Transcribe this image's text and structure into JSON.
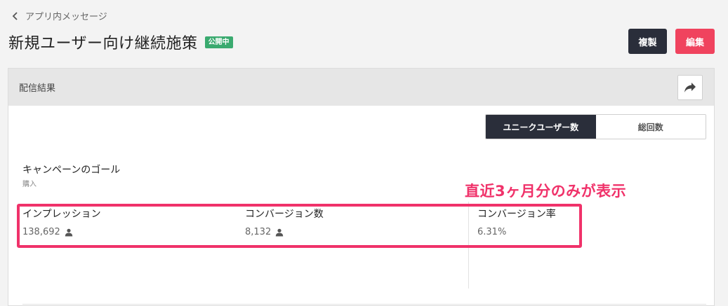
{
  "nav": {
    "back_label": "アプリ内メッセージ"
  },
  "header": {
    "title": "新規ユーザー向け継続施策",
    "status": "公開中",
    "duplicate_label": "複製",
    "edit_label": "編集"
  },
  "results": {
    "section_title": "配信結果",
    "toggle": {
      "unique_users": "ユニークユーザー数",
      "total_count": "総回数"
    },
    "goal": {
      "label": "キャンペーンのゴール",
      "value": "購入"
    },
    "annotation": "直近3ヶ月分のみが表示",
    "metrics": [
      {
        "label": "インプレッション",
        "value": "138,692",
        "icon": "user-icon"
      },
      {
        "label": "コンバージョン数",
        "value": "8,132",
        "icon": "user-icon"
      },
      {
        "label": "コンバージョン率",
        "value": "6.31%"
      }
    ]
  },
  "colors": {
    "accent": "#f0435e",
    "dark": "#2a2e3a",
    "status_green": "#3aaa6f",
    "annotation_pink": "#f0326a"
  }
}
